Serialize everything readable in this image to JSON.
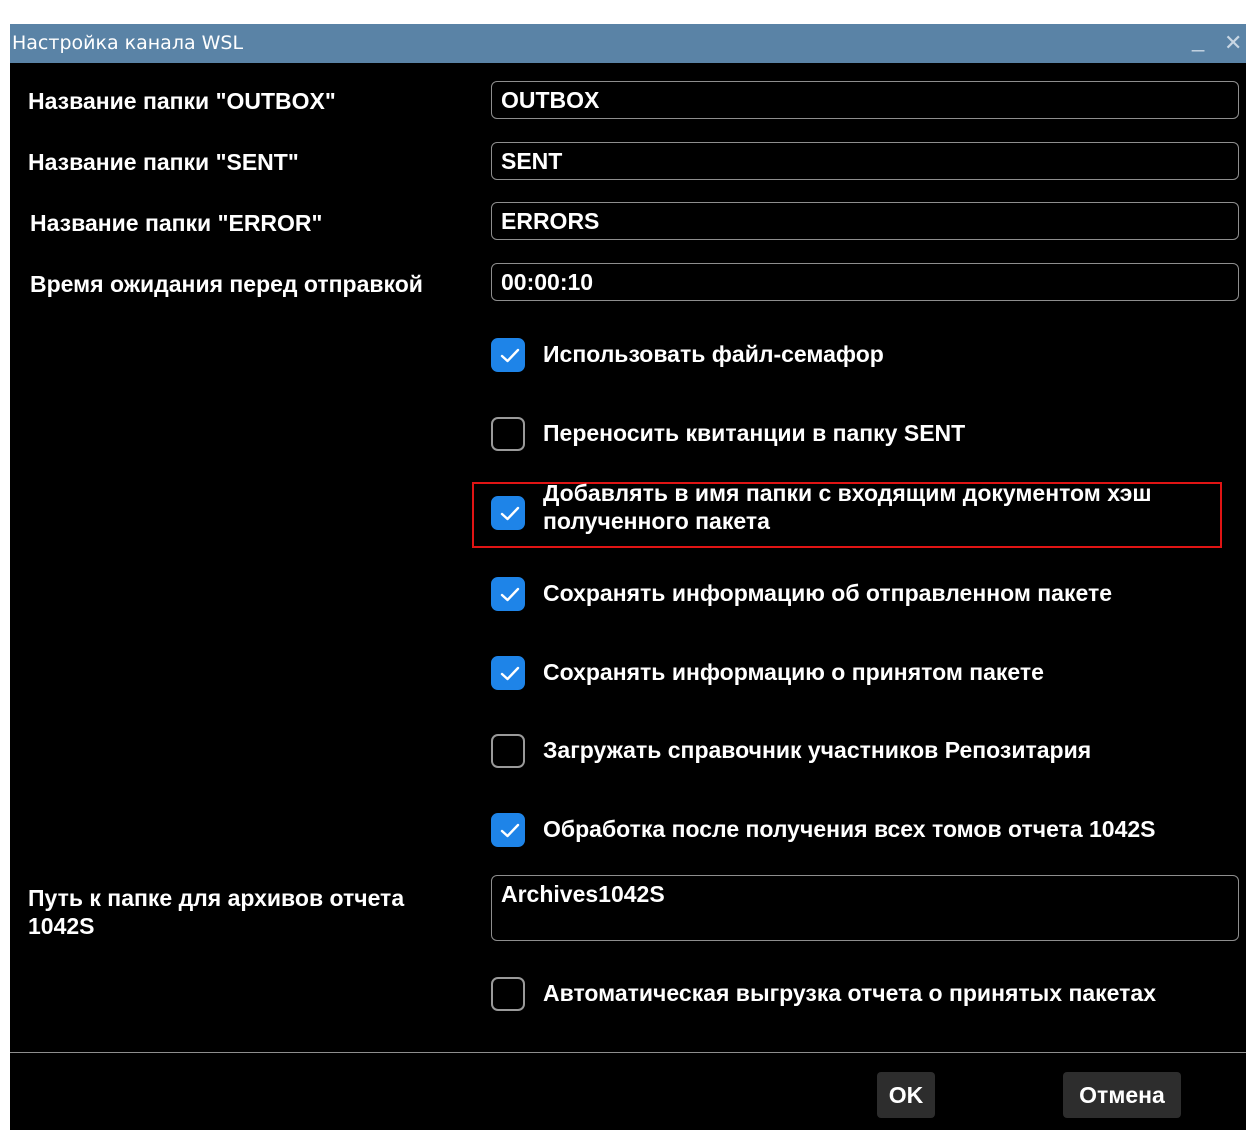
{
  "window": {
    "title": "Настройка канала WSL",
    "minimize_symbol": "_",
    "close_symbol": "✕"
  },
  "fields": {
    "outbox": {
      "label": "Название папки \"OUTBOX\"",
      "value": "OUTBOX"
    },
    "sent": {
      "label": "Название папки \"SENT\"",
      "value": "SENT"
    },
    "error": {
      "label": "Название папки \"ERROR\"",
      "value": "ERRORS"
    },
    "wait_time": {
      "label": "Время ожидания перед отправкой",
      "value": "00:00:10"
    },
    "archive_path": {
      "label": "Путь к папке для архивов отчета 1042S",
      "value": "Archives1042S"
    }
  },
  "checkboxes": [
    {
      "label": "Использовать файл-семафор",
      "checked": true
    },
    {
      "label": "Переносить квитанции в папку SENT",
      "checked": false
    },
    {
      "label": "Добавлять в имя папки с входящим документом хэш полученного пакета",
      "checked": true
    },
    {
      "label": "Сохранять информацию об отправленном пакете",
      "checked": true
    },
    {
      "label": "Сохранять информацию о принятом пакете",
      "checked": true
    },
    {
      "label": "Загружать справочник участников Репозитария",
      "checked": false
    },
    {
      "label": "Обработка после получения всех томов отчета 1042S",
      "checked": true
    },
    {
      "label": "Автоматическая выгрузка отчета о принятых пакетах",
      "checked": false
    }
  ],
  "buttons": {
    "ok": "OK",
    "cancel": "Отмена"
  },
  "colors": {
    "titlebar": "#5a83a6",
    "checkbox_checked": "#1e84e8",
    "highlight": "#e01414",
    "background": "#000000"
  }
}
